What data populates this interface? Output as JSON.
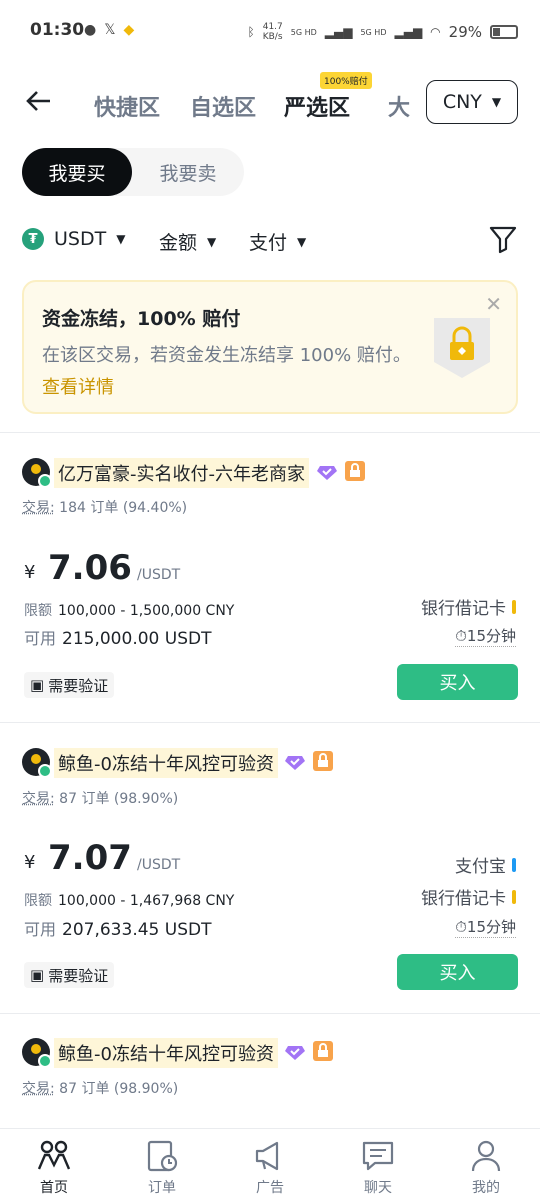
{
  "status_bar": {
    "time": "01:30",
    "net_speed": "41.7",
    "net_unit": "KB/s",
    "sig1": "5G HD",
    "sig2": "5G HD",
    "battery": "29%"
  },
  "nav": {
    "tabs": [
      "快捷区",
      "自选区",
      "严选区",
      "大"
    ],
    "active_tab": "严选区",
    "tag": "100%赔付",
    "currency": "CNY"
  },
  "toggle": {
    "buy": "我要买",
    "sell": "我要卖"
  },
  "filters": {
    "asset": "USDT",
    "amount": "金额",
    "payment": "支付"
  },
  "notice": {
    "title": "资金冻结，100% 赔付",
    "body": "在该区交易，若资金发生冻结享 100% 赔付。",
    "link": "查看详情"
  },
  "labels": {
    "trade": "交易:",
    "orders": "订单",
    "limit": "限额",
    "available": "可用",
    "unit": "/USDT",
    "need_verify": "需要验证",
    "buy": "买入",
    "minutes": "15分钟"
  },
  "ads": [
    {
      "name": "亿万富豪-实名收付-六年老商家",
      "orders": "184",
      "rate": "(94.40%)",
      "price": "7.06",
      "limit": "100,000 - 1,500,000 CNY",
      "available": "215,000.00 USDT",
      "payments": [
        {
          "name": "银行借记卡",
          "color": "#f0b90b"
        }
      ]
    },
    {
      "name": "鲸鱼-0冻结十年风控可验资",
      "orders": "87",
      "rate": "(98.90%)",
      "price": "7.07",
      "limit": "100,000 - 1,467,968 CNY",
      "available": "207,633.45 USDT",
      "payments": [
        {
          "name": "支付宝",
          "color": "#1e9af3"
        },
        {
          "name": "银行借记卡",
          "color": "#f0b90b"
        }
      ]
    },
    {
      "name": "鲸鱼-0冻结十年风控可验资",
      "orders": "87",
      "rate": "(98.90%)"
    }
  ],
  "bottom_nav": [
    "首页",
    "订单",
    "广告",
    "聊天",
    "我的"
  ]
}
